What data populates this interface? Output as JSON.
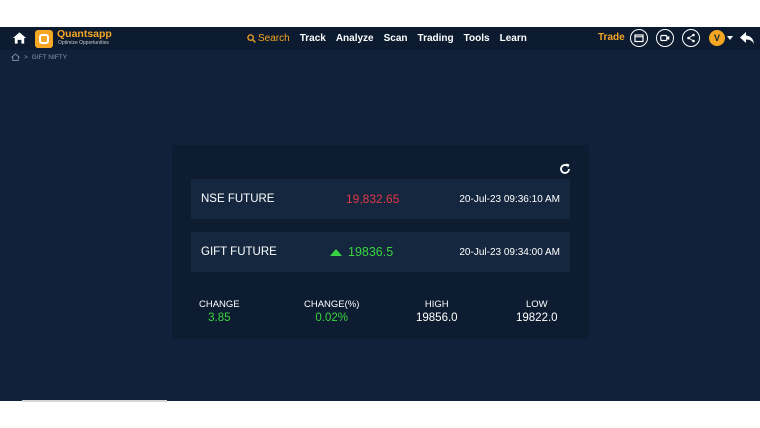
{
  "brand": {
    "name": "Quantsapp",
    "tagline": "Optimize Opportunities"
  },
  "nav": {
    "search_label": "Search",
    "items": [
      "Track",
      "Analyze",
      "Scan",
      "Trading",
      "Tools",
      "Learn"
    ]
  },
  "header_right": {
    "trade_label": "Trade",
    "avatar_letter": "V"
  },
  "breadcrumb": {
    "current": "GIFT NIFTY"
  },
  "quotes": [
    {
      "name": "NSE FUTURE",
      "price": "19,832.65",
      "time": "20-Jul-23 09:36:10 AM",
      "price_color": "#e03a45"
    },
    {
      "name": "GIFT FUTURE",
      "price": "19836.5",
      "time": "20-Jul-23 09:34:00 AM",
      "price_color": "#39d43f"
    }
  ],
  "stats": {
    "change_label": "CHANGE",
    "change_value": "3.85",
    "change_pct_label": "CHANGE(%)",
    "change_pct_value": "0.02%",
    "high_label": "HIGH",
    "high_value": "19856.0",
    "low_label": "LOW",
    "low_value": "19822.0"
  },
  "colors": {
    "background": "#102139",
    "accent": "#f5a623",
    "up": "#39d43f",
    "down": "#e03a45"
  },
  "icons": [
    "home-icon",
    "search-icon",
    "window-icon",
    "video-icon",
    "share-icon",
    "back-arrow-icon",
    "refresh-icon",
    "arrow-up-icon"
  ]
}
